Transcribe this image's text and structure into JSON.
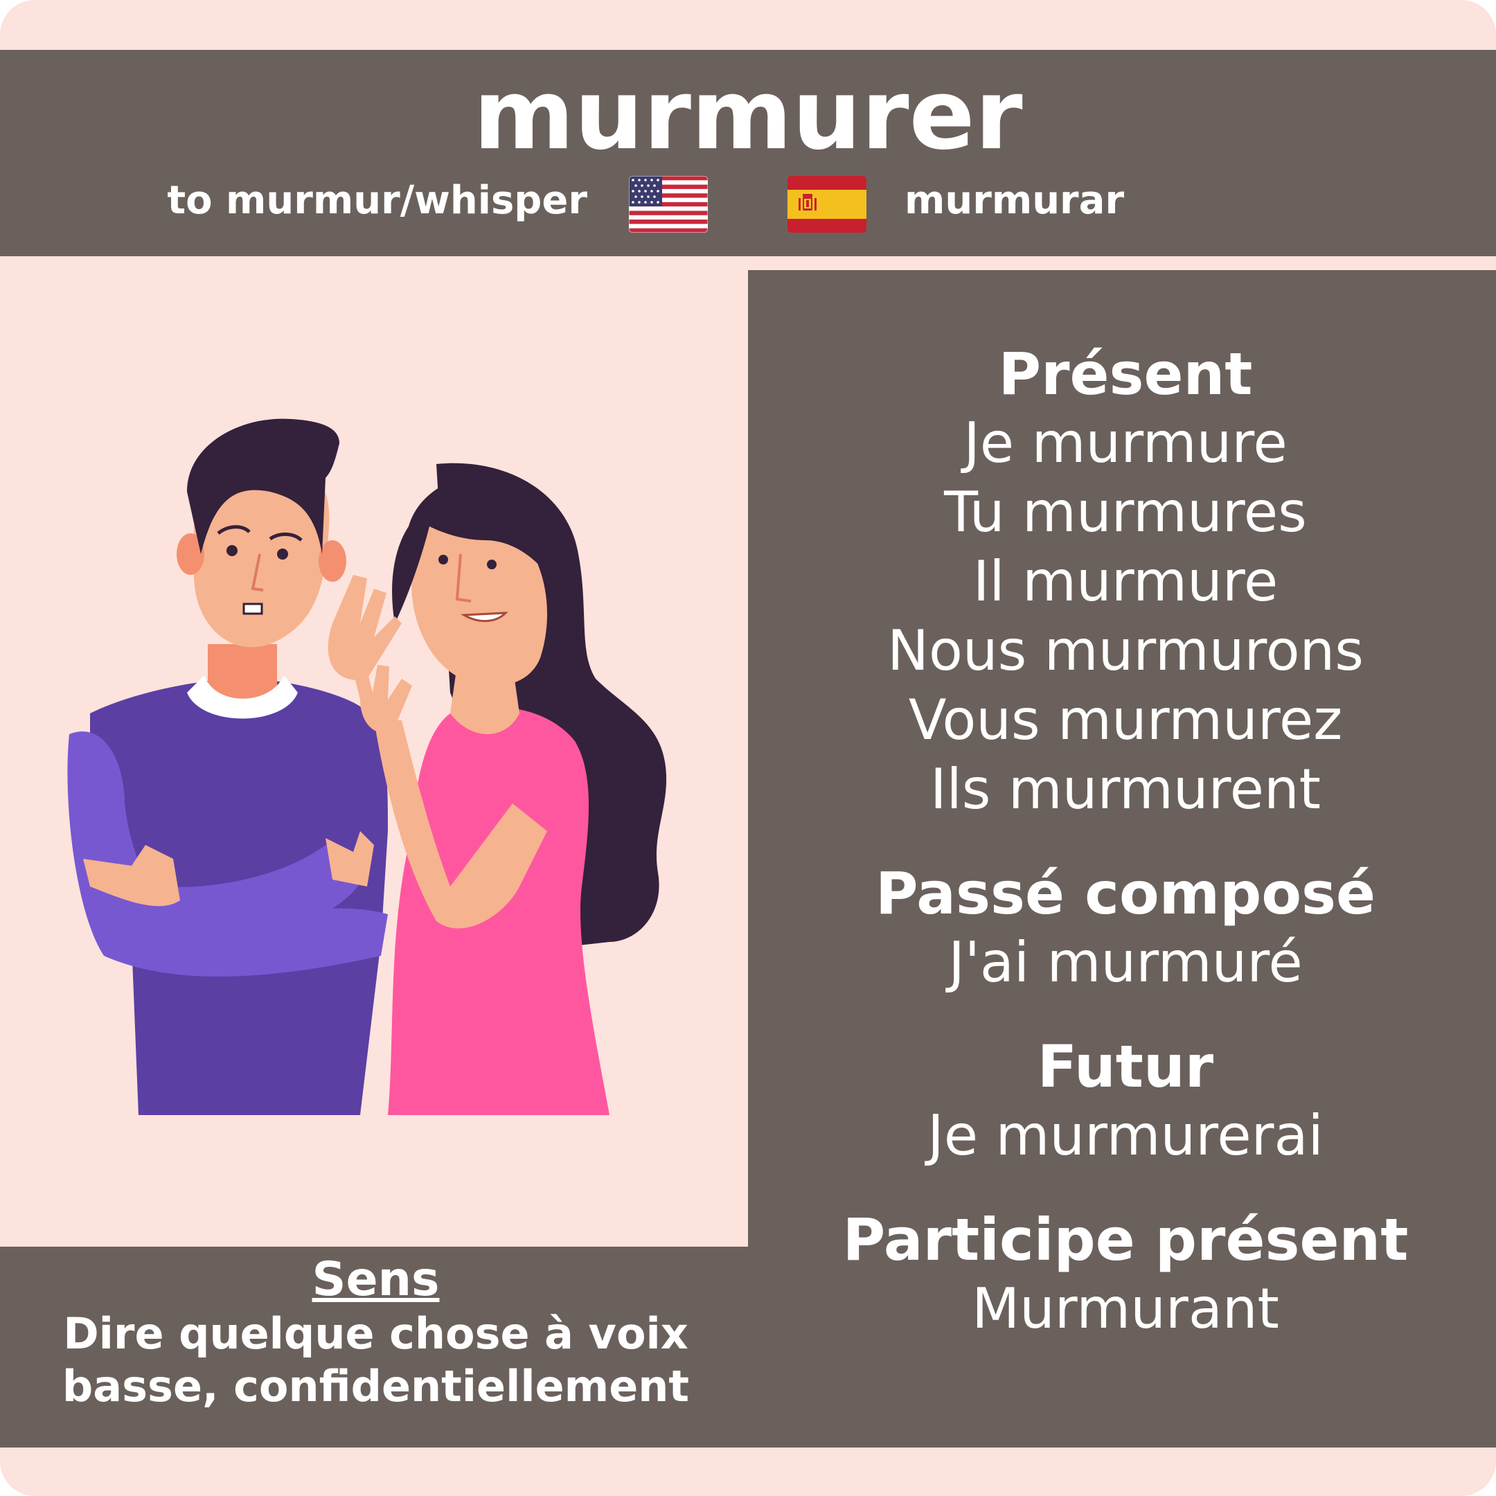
{
  "verb": "murmurer",
  "translations": {
    "english": "to murmur/whisper",
    "spanish": "murmurar"
  },
  "flags": {
    "english": "us-flag-icon",
    "spanish": "spain-flag-icon"
  },
  "illustration": "man-and-whispering-woman-illustration",
  "colors": {
    "background": "#fde3dd",
    "panel": "#6b615c",
    "text": "#ffffff"
  },
  "conjugation": {
    "present": {
      "title": "Présent",
      "forms": [
        "Je murmure",
        "Tu murmures",
        "Il murmure",
        "Nous murmurons",
        "Vous murmurez",
        "Ils murmurent"
      ]
    },
    "passe_compose": {
      "title": "Passé composé",
      "form": "J'ai murmuré"
    },
    "futur": {
      "title": "Futur",
      "form": "Je murmurerai"
    },
    "participe_present": {
      "title": "Participe présent",
      "form": "Murmurant"
    }
  },
  "meaning": {
    "heading": "Sens",
    "line1": "Dire quelque chose à voix",
    "line2": "basse, confidentiellement"
  }
}
